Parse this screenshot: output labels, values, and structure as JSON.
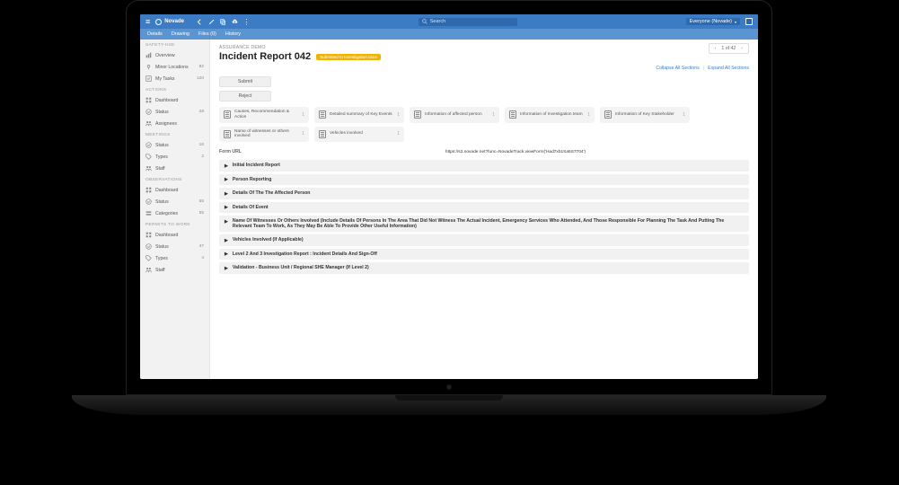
{
  "brand": "Novade",
  "search_placeholder": "Search",
  "user_label": "Everyone (Novade)",
  "tabs": [
    "Details",
    "Drawing",
    "Files (0)",
    "History"
  ],
  "sidebar": [
    {
      "title": "SAFETY-HSE",
      "items": [
        {
          "icon": "chart",
          "label": "Overview",
          "count": ""
        },
        {
          "icon": "pin",
          "label": "Minor Locations",
          "count": "82"
        },
        {
          "icon": "task",
          "label": "My Tasks",
          "count": "120"
        }
      ]
    },
    {
      "title": "ACTIONS",
      "items": [
        {
          "icon": "dash",
          "label": "Dashboard",
          "count": ""
        },
        {
          "icon": "status",
          "label": "Status",
          "count": "28"
        },
        {
          "icon": "people",
          "label": "Assignees",
          "count": ""
        }
      ]
    },
    {
      "title": "MEETINGS",
      "items": [
        {
          "icon": "status",
          "label": "Status",
          "count": "16"
        },
        {
          "icon": "types",
          "label": "Types",
          "count": "2"
        },
        {
          "icon": "people",
          "label": "Staff",
          "count": ""
        }
      ]
    },
    {
      "title": "OBSERVATIONS",
      "items": [
        {
          "icon": "dash",
          "label": "Dashboard",
          "count": ""
        },
        {
          "icon": "status",
          "label": "Status",
          "count": "55"
        },
        {
          "icon": "cat",
          "label": "Categories",
          "count": "55"
        }
      ]
    },
    {
      "title": "PERMITS TO WORK",
      "items": [
        {
          "icon": "dash",
          "label": "Dashboard",
          "count": ""
        },
        {
          "icon": "status",
          "label": "Status",
          "count": "47"
        },
        {
          "icon": "types",
          "label": "Types",
          "count": "4"
        },
        {
          "icon": "people",
          "label": "Staff",
          "count": ""
        }
      ]
    }
  ],
  "breadcrumb": "ASSURANCE DEMO",
  "page_title": "Incident Report 042",
  "status_label": "Submitted to Investigation team",
  "pager": {
    "text": "1 of 42"
  },
  "collapse_label": "Collapse All Sections",
  "expand_label": "Expand All Sections",
  "action_buttons": {
    "submit": "Submit",
    "reject": "Reject"
  },
  "attachments_row1": [
    {
      "label": "Causes, Recommendation & Action",
      "count": "1"
    },
    {
      "label": "Detailed summary of Key Events",
      "count": "1"
    },
    {
      "label": "Information of affected person",
      "count": "1"
    },
    {
      "label": "Information of Investigation team",
      "count": "1"
    },
    {
      "label": "Information of Key Stakeholder",
      "count": "1"
    }
  ],
  "attachments_row2": [
    {
      "label": "Name of witnesses or others involved",
      "count": "1"
    },
    {
      "label": "Vehicles involved",
      "count": "1"
    }
  ],
  "form_url_label": "Form URL",
  "form_url_value": "https://s2.novade.net?func=NovadeTrack.viewForm('Had7xb1Sa5S7704')",
  "sections": [
    {
      "label": "Initial Incident Report"
    },
    {
      "label": "Person Reporting"
    },
    {
      "label": "Details Of The The Affected Person"
    },
    {
      "label": "Details Of Event"
    },
    {
      "label": "Name Of Witnesses Or Others Involved (Include Details Of Persons In The Area That Did Not Witness The Actual Incident, Emergency Services Who Attended, And Those Responsible For Planning The Task And Putting The Relevant Team To Work, As They May Be Able To Provide Other Useful Information)"
    },
    {
      "label": "Vehicles Involved (If Applicable)"
    },
    {
      "label": "Level 2 And 3 Investigation Report : Incident Details And Sign-Off"
    },
    {
      "label": "Validation - Business Unit / Regional SHE Manager (If Level 2)"
    }
  ]
}
